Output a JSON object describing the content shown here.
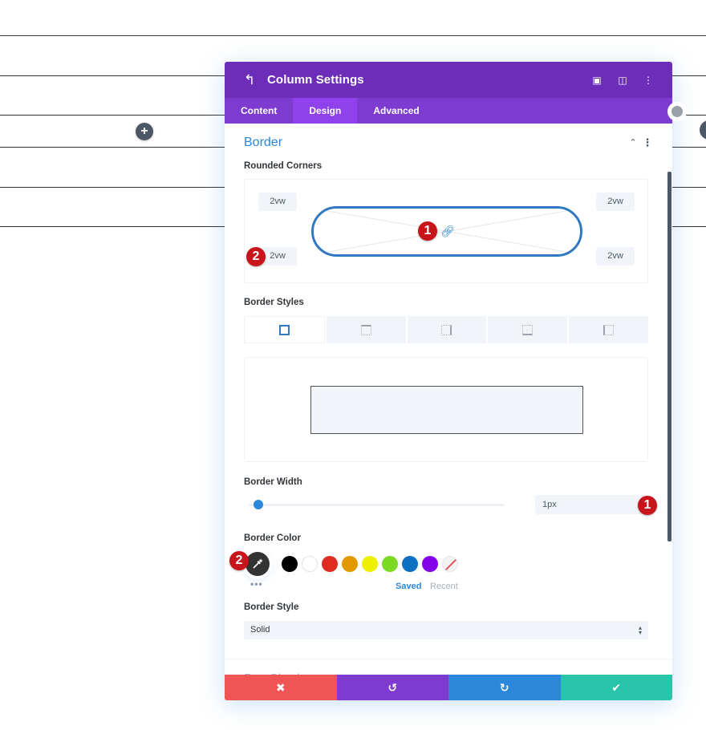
{
  "background": {
    "add_row_label": "+"
  },
  "modal": {
    "title": "Column Settings",
    "header_icons": [
      "back-icon",
      "focus-mode-icon",
      "split-view-icon",
      "more-options-icon"
    ],
    "tabs": [
      {
        "label": "Content",
        "active": false
      },
      {
        "label": "Design",
        "active": true
      },
      {
        "label": "Advanced",
        "active": false
      }
    ],
    "section": {
      "title": "Border",
      "rounded_corners": {
        "label": "Rounded Corners",
        "top_left": "2vw",
        "top_right": "2vw",
        "bottom_left": "2vw",
        "bottom_right": "2vw",
        "linked": true
      },
      "border_styles": {
        "label": "Border Styles",
        "options": [
          "all",
          "top",
          "right",
          "bottom",
          "left"
        ],
        "selected": "all"
      },
      "border_width": {
        "label": "Border Width",
        "value": "1px",
        "slider_fraction": 0.02
      },
      "border_color": {
        "label": "Border Color",
        "swatches": [
          "#000000",
          "#ffffff",
          "#e02b20",
          "#e09900",
          "#edf000",
          "#7cda24",
          "#0c71c3",
          "#8300e9",
          "none"
        ],
        "saved_label": "Saved",
        "recent_label": "Recent",
        "more_label": "•••"
      },
      "border_style": {
        "label": "Border Style",
        "value": "Solid"
      }
    },
    "next_section_title": "Box Shadow",
    "annotations": {
      "corner_link": "1",
      "corner_bottom_left": "2",
      "border_width": "1",
      "eyedropper": "2"
    },
    "footer": {
      "cancel_icon": "✖",
      "undo_icon": "↺",
      "redo_icon": "↻",
      "save_icon": "✔"
    }
  },
  "colors": {
    "header": "#6c2eb9",
    "tabs": "#7d3bcf",
    "accent": "#2b87da",
    "cancel": "#ef5555",
    "undo": "#7e3bd0",
    "redo": "#2b87da",
    "save": "#29c4a9",
    "badge": "#c8151b"
  }
}
